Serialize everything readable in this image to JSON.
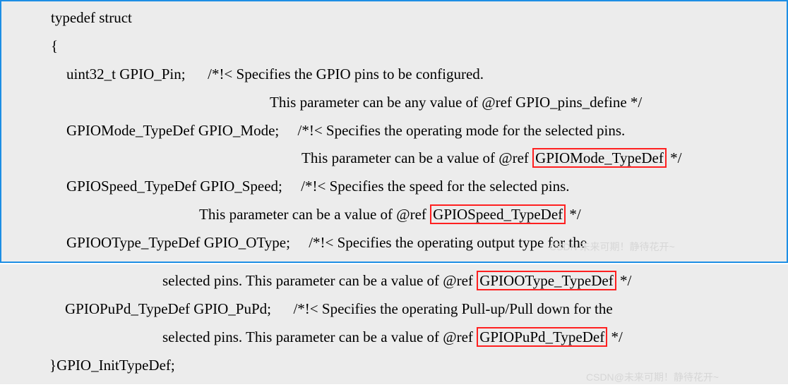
{
  "code": {
    "line1": "typedef struct",
    "line2": "{",
    "line3a": "uint32_t GPIO_Pin;      /*!< Specifies the GPIO pins to be configured.",
    "line3b": "This parameter can be any value of @ref GPIO_pins_define */",
    "line4a": "GPIOMode_TypeDef GPIO_Mode;     /*!< Specifies the operating mode for the selected pins.",
    "line4b_pre": "This parameter can be a value of @ref ",
    "line4b_ref": "GPIOMode_TypeDef",
    "line4b_post": " */",
    "line5a": "GPIOSpeed_TypeDef GPIO_Speed;     /*!< Specifies the speed for the selected pins.",
    "line5b_pre": "This parameter can be a value of @ref ",
    "line5b_ref": "GPIOSpeed_TypeDef",
    "line5b_post": " */",
    "line6a": "GPIOOType_TypeDef GPIO_OType;     /*!< Specifies the operating output type for the",
    "line6b_pre": "selected pins. This parameter can be a value of @ref ",
    "line6b_ref": "GPIOOType_TypeDef",
    "line6b_post": " */",
    "line7a": "GPIOPuPd_TypeDef GPIO_PuPd;      /*!< Specifies the operating Pull-up/Pull down for the",
    "line7b_pre": "selected pins. This parameter can be a value of @ref ",
    "line7b_ref": "GPIOPuPd_TypeDef",
    "line7b_post": " */",
    "line8": "}GPIO_InitTypeDef;"
  },
  "watermarks": {
    "w1": "CSDN 未来可期！静待花开~",
    "w2": "CSDN@未来可期！静待花开~"
  }
}
